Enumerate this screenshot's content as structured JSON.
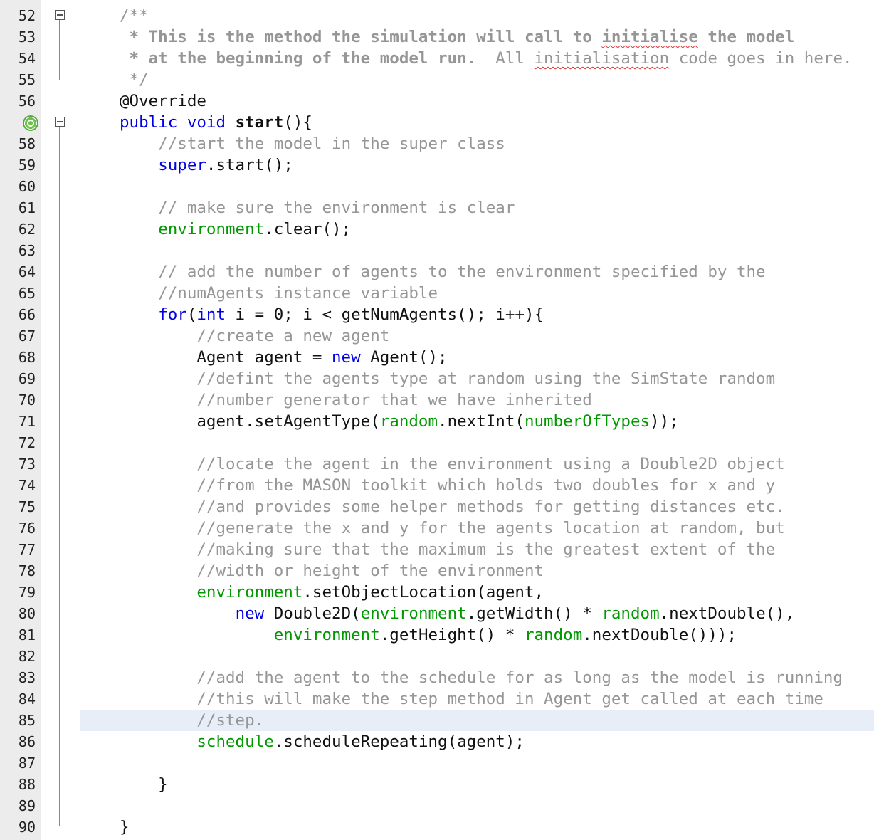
{
  "lines": [
    {
      "n": "52",
      "t": [
        {
          "c": "c",
          "s": "/**"
        }
      ]
    },
    {
      "n": "53",
      "t": [
        {
          "c": "cb",
          "s": " * This is the method the simulation will call to "
        },
        {
          "c": "cb sq",
          "s": "initialise"
        },
        {
          "c": "cb",
          "s": " the model"
        }
      ]
    },
    {
      "n": "54",
      "t": [
        {
          "c": "cb",
          "s": " * at the beginning of the model run."
        },
        {
          "c": "c",
          "s": "  All "
        },
        {
          "c": "c sq",
          "s": "initialisation"
        },
        {
          "c": "c",
          "s": " code goes in here."
        }
      ]
    },
    {
      "n": "55",
      "t": [
        {
          "c": "c",
          "s": " */"
        }
      ]
    },
    {
      "n": "56",
      "t": [
        {
          "c": "",
          "s": "@Override"
        }
      ]
    },
    {
      "n": "",
      "t": [
        {
          "c": "kw",
          "s": "public void "
        },
        {
          "c": "b",
          "s": "start"
        },
        {
          "c": "",
          "s": "(){"
        }
      ]
    },
    {
      "n": "58",
      "t": [
        {
          "c": "",
          "s": "    "
        },
        {
          "c": "c",
          "s": "//start the model in the super class"
        }
      ]
    },
    {
      "n": "59",
      "t": [
        {
          "c": "",
          "s": "    "
        },
        {
          "c": "kw",
          "s": "super"
        },
        {
          "c": "",
          "s": ".start();"
        }
      ]
    },
    {
      "n": "60",
      "t": []
    },
    {
      "n": "61",
      "t": [
        {
          "c": "",
          "s": "    "
        },
        {
          "c": "c",
          "s": "// make sure the environment is clear"
        }
      ]
    },
    {
      "n": "62",
      "t": [
        {
          "c": "",
          "s": "    "
        },
        {
          "c": "fld",
          "s": "environment"
        },
        {
          "c": "",
          "s": ".clear();"
        }
      ]
    },
    {
      "n": "63",
      "t": []
    },
    {
      "n": "64",
      "t": [
        {
          "c": "",
          "s": "    "
        },
        {
          "c": "c",
          "s": "// add the number of agents to the environment specified by the"
        }
      ]
    },
    {
      "n": "65",
      "t": [
        {
          "c": "",
          "s": "    "
        },
        {
          "c": "c",
          "s": "//numAgents instance variable"
        }
      ]
    },
    {
      "n": "66",
      "t": [
        {
          "c": "",
          "s": "    "
        },
        {
          "c": "kw",
          "s": "for"
        },
        {
          "c": "",
          "s": "("
        },
        {
          "c": "kw",
          "s": "int"
        },
        {
          "c": "",
          "s": " i = 0; i < getNumAgents(); i++){"
        }
      ]
    },
    {
      "n": "67",
      "t": [
        {
          "c": "",
          "s": "        "
        },
        {
          "c": "c",
          "s": "//create a new agent"
        }
      ]
    },
    {
      "n": "68",
      "t": [
        {
          "c": "",
          "s": "        Agent agent = "
        },
        {
          "c": "kw",
          "s": "new"
        },
        {
          "c": "",
          "s": " Agent();"
        }
      ]
    },
    {
      "n": "69",
      "t": [
        {
          "c": "",
          "s": "        "
        },
        {
          "c": "c",
          "s": "//defint the agents type at random using the SimState random"
        }
      ]
    },
    {
      "n": "70",
      "t": [
        {
          "c": "",
          "s": "        "
        },
        {
          "c": "c",
          "s": "//number generator that we have inherited"
        }
      ]
    },
    {
      "n": "71",
      "t": [
        {
          "c": "",
          "s": "        agent.setAgentType("
        },
        {
          "c": "fld",
          "s": "random"
        },
        {
          "c": "",
          "s": ".nextInt("
        },
        {
          "c": "fld",
          "s": "numberOfTypes"
        },
        {
          "c": "",
          "s": "));"
        }
      ]
    },
    {
      "n": "72",
      "t": []
    },
    {
      "n": "73",
      "t": [
        {
          "c": "",
          "s": "        "
        },
        {
          "c": "c",
          "s": "//locate the agent in the environment using a Double2D object"
        }
      ]
    },
    {
      "n": "74",
      "t": [
        {
          "c": "",
          "s": "        "
        },
        {
          "c": "c",
          "s": "//from the MASON toolkit which holds two doubles for x and y"
        }
      ]
    },
    {
      "n": "75",
      "t": [
        {
          "c": "",
          "s": "        "
        },
        {
          "c": "c",
          "s": "//and provides some helper methods for getting distances etc."
        }
      ]
    },
    {
      "n": "76",
      "t": [
        {
          "c": "",
          "s": "        "
        },
        {
          "c": "c",
          "s": "//generate the x and y for the agents location at random, but"
        }
      ]
    },
    {
      "n": "77",
      "t": [
        {
          "c": "",
          "s": "        "
        },
        {
          "c": "c",
          "s": "//making sure that the maximum is the greatest extent of the"
        }
      ]
    },
    {
      "n": "78",
      "t": [
        {
          "c": "",
          "s": "        "
        },
        {
          "c": "c",
          "s": "//width or height of the environment"
        }
      ]
    },
    {
      "n": "79",
      "t": [
        {
          "c": "",
          "s": "        "
        },
        {
          "c": "fld",
          "s": "environment"
        },
        {
          "c": "",
          "s": ".setObjectLocation(agent,"
        }
      ]
    },
    {
      "n": "80",
      "t": [
        {
          "c": "",
          "s": "            "
        },
        {
          "c": "kw",
          "s": "new"
        },
        {
          "c": "",
          "s": " Double2D("
        },
        {
          "c": "fld",
          "s": "environment"
        },
        {
          "c": "",
          "s": ".getWidth() * "
        },
        {
          "c": "fld",
          "s": "random"
        },
        {
          "c": "",
          "s": ".nextDouble(),"
        }
      ]
    },
    {
      "n": "81",
      "t": [
        {
          "c": "",
          "s": "                "
        },
        {
          "c": "fld",
          "s": "environment"
        },
        {
          "c": "",
          "s": ".getHeight() * "
        },
        {
          "c": "fld",
          "s": "random"
        },
        {
          "c": "",
          "s": ".nextDouble()));"
        }
      ]
    },
    {
      "n": "82",
      "t": []
    },
    {
      "n": "83",
      "t": [
        {
          "c": "",
          "s": "        "
        },
        {
          "c": "c",
          "s": "//add the agent to the schedule for as long as the model is running"
        }
      ]
    },
    {
      "n": "84",
      "t": [
        {
          "c": "",
          "s": "        "
        },
        {
          "c": "c",
          "s": "//this will make the step method in Agent get called at each time"
        }
      ]
    },
    {
      "n": "85",
      "t": [
        {
          "c": "",
          "s": "        "
        },
        {
          "c": "c",
          "s": "//step."
        }
      ],
      "hl": true
    },
    {
      "n": "86",
      "t": [
        {
          "c": "",
          "s": "        "
        },
        {
          "c": "fld",
          "s": "schedule"
        },
        {
          "c": "",
          "s": ".scheduleRepeating(agent);"
        }
      ]
    },
    {
      "n": "87",
      "t": []
    },
    {
      "n": "88",
      "t": [
        {
          "c": "",
          "s": "    }"
        }
      ]
    },
    {
      "n": "89",
      "t": []
    },
    {
      "n": "90",
      "t": [
        {
          "c": "",
          "s": "}"
        }
      ]
    }
  ]
}
